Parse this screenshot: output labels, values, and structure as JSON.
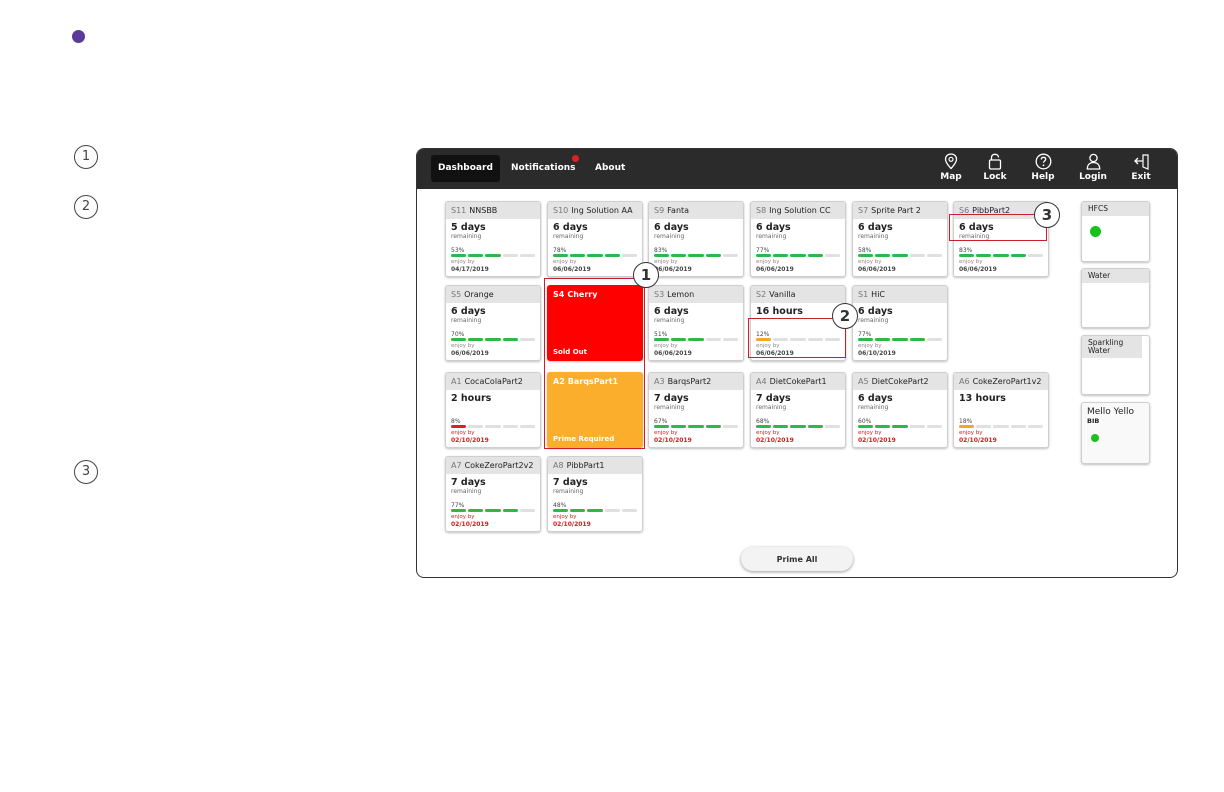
{
  "side_numbers": [
    "1",
    "2",
    "3"
  ],
  "nav": {
    "dashboard": "Dashboard",
    "notifications": "Notifications",
    "about": "About"
  },
  "toolbar": [
    {
      "label": "Map",
      "icon": "map-pin-icon"
    },
    {
      "label": "Lock",
      "icon": "lock-icon"
    },
    {
      "label": "Help",
      "icon": "help-icon"
    },
    {
      "label": "Login",
      "icon": "user-icon"
    },
    {
      "label": "Exit",
      "icon": "exit-icon"
    }
  ],
  "cards": {
    "s11": {
      "slot": "S11",
      "name": "NNSBB",
      "time": "5 days",
      "sub": "remaining",
      "pct": "53%",
      "enjoy": "enjoy by",
      "date": "04/17/2019",
      "fill": 3
    },
    "s10": {
      "slot": "S10",
      "name": "Ing Solution AA",
      "time": "6 days",
      "sub": "remaining",
      "pct": "78%",
      "enjoy": "enjoy by",
      "date": "06/06/2019",
      "fill": 4
    },
    "s9": {
      "slot": "S9",
      "name": "Fanta",
      "time": "6 days",
      "sub": "remaining",
      "pct": "83%",
      "enjoy": "enjoy by",
      "date": "06/06/2019",
      "fill": 4
    },
    "s8": {
      "slot": "S8",
      "name": "Ing Solution CC",
      "time": "6 days",
      "sub": "remaining",
      "pct": "77%",
      "enjoy": "enjoy by",
      "date": "06/06/2019",
      "fill": 4
    },
    "s7": {
      "slot": "S7",
      "name": "Sprite Part 2",
      "time": "6 days",
      "sub": "remaining",
      "pct": "58%",
      "enjoy": "enjoy by",
      "date": "06/06/2019",
      "fill": 3
    },
    "s6": {
      "slot": "S6",
      "name": "PibbPart2",
      "time": "6 days",
      "sub": "remaining",
      "pct": "83%",
      "enjoy": "enjoy by",
      "date": "06/06/2019",
      "fill": 4
    },
    "s5": {
      "slot": "S5",
      "name": "Orange",
      "time": "6 days",
      "sub": "remaining",
      "pct": "70%",
      "enjoy": "enjoy by",
      "date": "06/06/2019",
      "fill": 4
    },
    "s4": {
      "slot": "S4",
      "name": "Cherry",
      "status": "Sold Out"
    },
    "s3": {
      "slot": "S3",
      "name": "Lemon",
      "time": "6 days",
      "sub": "remaining",
      "pct": "51%",
      "enjoy": "enjoy by",
      "date": "06/06/2019",
      "fill": 3
    },
    "s2": {
      "slot": "S2",
      "name": "Vanilla",
      "time": "16 hours",
      "sub": "",
      "pct": "12%",
      "enjoy": "enjoy by",
      "date": "06/06/2019",
      "fill": 1
    },
    "s1": {
      "slot": "S1",
      "name": "HiC",
      "time": "6 days",
      "sub": "remaining",
      "pct": "77%",
      "enjoy": "enjoy by",
      "date": "06/10/2019",
      "fill": 4
    },
    "a1": {
      "slot": "A1",
      "name": "CocaColaPart2",
      "time": "2 hours",
      "sub": "",
      "pct": "8%",
      "enjoy": "enjoy by",
      "date": "02/10/2019",
      "fill": 1
    },
    "a2": {
      "slot": "A2",
      "name": "BarqsPart1",
      "status": "Prime Required"
    },
    "a3": {
      "slot": "A3",
      "name": "BarqsPart2",
      "time": "7 days",
      "sub": "remaining",
      "pct": "67%",
      "enjoy": "enjoy by",
      "date": "02/10/2019",
      "fill": 4
    },
    "a4": {
      "slot": "A4",
      "name": "DietCokePart1",
      "time": "7 days",
      "sub": "remaining",
      "pct": "68%",
      "enjoy": "enjoy by",
      "date": "02/10/2019",
      "fill": 4
    },
    "a5": {
      "slot": "A5",
      "name": "DietCokePart2",
      "time": "6 days",
      "sub": "remaining",
      "pct": "60%",
      "enjoy": "enjoy by",
      "date": "02/10/2019",
      "fill": 3
    },
    "a6": {
      "slot": "A6",
      "name": "CokeZeroPart1v2",
      "time": "13 hours",
      "sub": "",
      "pct": "18%",
      "enjoy": "enjoy by",
      "date": "02/10/2019",
      "fill": 1
    },
    "a7": {
      "slot": "A7",
      "name": "CokeZeroPart2v2",
      "time": "7 days",
      "sub": "remaining",
      "pct": "77%",
      "enjoy": "enjoy by",
      "date": "02/10/2019",
      "fill": 4
    },
    "a8": {
      "slot": "A8",
      "name": "PibbPart1",
      "time": "7 days",
      "sub": "remaining",
      "pct": "48%",
      "enjoy": "enjoy by",
      "date": "02/10/2019",
      "fill": 3
    }
  },
  "side_panel": {
    "hfcs": "HFCS",
    "water": "Water",
    "sparkling": "Sparkling Water",
    "mello": "Mello Yello",
    "mello_sub": "BIB"
  },
  "prime_all": "Prime All",
  "callouts": [
    "1",
    "2",
    "3"
  ],
  "colors": {
    "bar_green": "#2db84a",
    "bar_orange": "#f5a623",
    "bar_red": "#e02020",
    "sold_out": "#ff0000",
    "prime_required": "#fbae2c",
    "highlight": "#c8202a",
    "accent_bullet": "#5b3a99"
  }
}
